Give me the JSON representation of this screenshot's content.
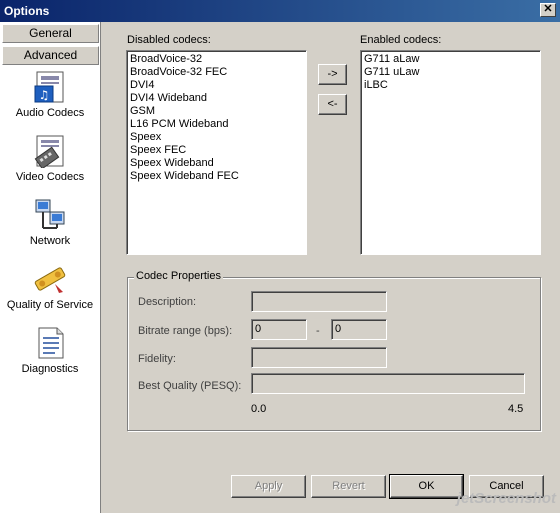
{
  "window": {
    "title": "Options",
    "close_symbol": "✕"
  },
  "sidebar": {
    "tabs": [
      "General",
      "Advanced"
    ],
    "items": [
      {
        "label": "Audio Codecs",
        "icon": "audio-codecs-icon"
      },
      {
        "label": "Video Codecs",
        "icon": "video-codecs-icon"
      },
      {
        "label": "Network",
        "icon": "network-icon"
      },
      {
        "label": "Quality of Service",
        "icon": "quality-of-service-icon"
      },
      {
        "label": "Diagnostics",
        "icon": "diagnostics-icon"
      }
    ]
  },
  "codecs": {
    "disabled_label": "Disabled codecs:",
    "enabled_label": "Enabled codecs:",
    "disabled": [
      "BroadVoice-32",
      "BroadVoice-32 FEC",
      "DVI4",
      "DVI4 Wideband",
      "GSM",
      "L16 PCM Wideband",
      "Speex",
      "Speex FEC",
      "Speex Wideband",
      "Speex Wideband FEC"
    ],
    "enabled": [
      "G711 aLaw",
      "G711 uLaw",
      "iLBC"
    ],
    "move_right": "->",
    "move_left": "<-"
  },
  "codec_properties": {
    "title": "Codec Properties",
    "description_label": "Description:",
    "description_value": "",
    "bitrate_label": "Bitrate range (bps):",
    "bitrate_min": "0",
    "bitrate_sep": "-",
    "bitrate_max": "0",
    "fidelity_label": "Fidelity:",
    "fidelity_value": "",
    "pesq_label": "Best Quality (PESQ):",
    "pesq_min": "0.0",
    "pesq_max": "4.5"
  },
  "footer": {
    "apply": "Apply",
    "revert": "Revert",
    "ok": "OK",
    "cancel": "Cancel"
  },
  "watermark": "jetScreenshot"
}
